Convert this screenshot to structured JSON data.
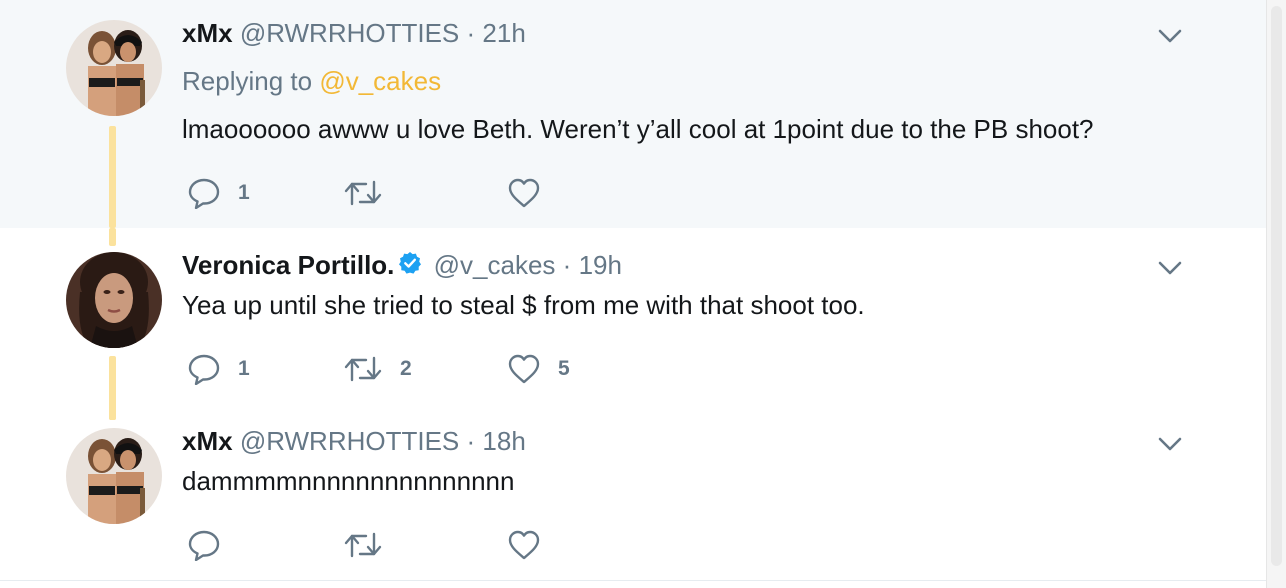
{
  "tweets": [
    {
      "name": "xMx",
      "handle": "@RWRRHOTTIES",
      "time": "21h",
      "reply_prefix": "Replying to",
      "reply_mention": "@v_cakes",
      "text": "lmaoooooo awww u love Beth. Weren’t y’all cool at 1point due to the PB shoot?",
      "verified": false,
      "replies": "1",
      "retweets": "",
      "likes": ""
    },
    {
      "name": "Veronica Portillo.",
      "handle": "@v_cakes",
      "time": "19h",
      "text": "Yea up until she tried to steal $ from me with that shoot too.",
      "verified": true,
      "replies": "1",
      "retweets": "2",
      "likes": "5"
    },
    {
      "name": "xMx",
      "handle": "@RWRRHOTTIES",
      "time": "18h",
      "text": "dammmmnnnnnnnnnnnnnnn",
      "verified": false,
      "replies": "",
      "retweets": "",
      "likes": ""
    }
  ],
  "separator": "·",
  "colors": {
    "highlight_bg": "#f5f8fa",
    "thread_line": "#fbe29d",
    "mention": "#f2b836",
    "secondary": "#657786",
    "verified": "#1da1f2"
  },
  "icons": [
    "reply-icon",
    "retweet-icon",
    "like-icon",
    "chevron-down-icon",
    "verified-badge-icon"
  ]
}
